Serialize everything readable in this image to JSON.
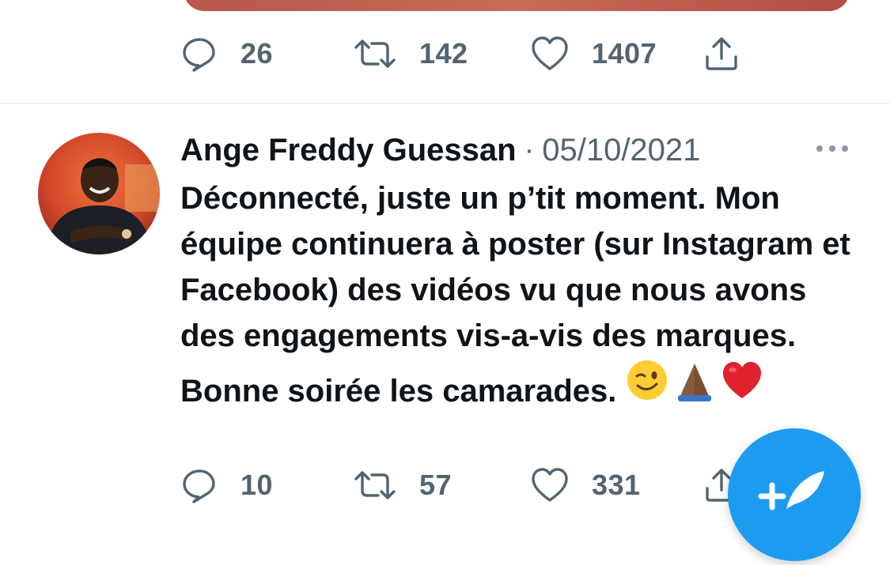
{
  "tweet_prev": {
    "replies": "26",
    "retweets": "142",
    "likes": "1407"
  },
  "tweet": {
    "author": "Ange Freddy Guessan",
    "separator": "·",
    "date": "05/10/2021",
    "text": "Déconnecté, juste un p’tit moment. Mon équipe continuera à poster (sur Instagram et Facebook) des vidéos vu que nous avons des engagements vis-a-vis des marques. Bonne soirée les camarades.",
    "emojis": [
      "winking-face",
      "folded-hands",
      "red-heart"
    ],
    "replies": "10",
    "retweets": "57",
    "likes": "331"
  },
  "colors": {
    "accent": "#1d9bf0",
    "text": "#0f1419",
    "secondary": "#536471",
    "divider": "#eff3f4"
  },
  "icons": [
    "reply-icon",
    "retweet-icon",
    "like-icon",
    "share-icon",
    "more-icon",
    "compose-icon"
  ]
}
